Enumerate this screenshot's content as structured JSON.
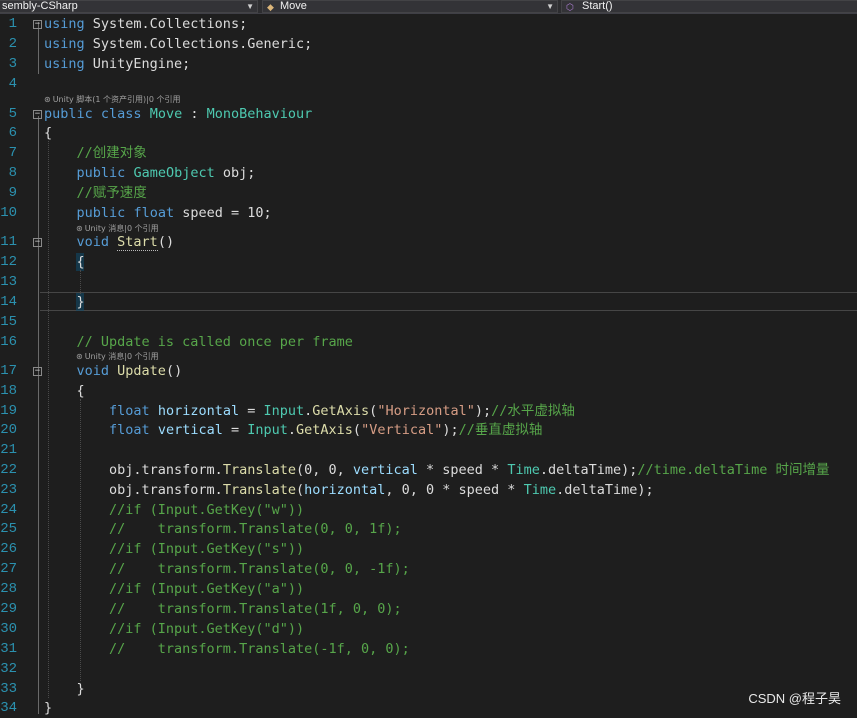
{
  "toolbar": {
    "project": "sembly-CSharp",
    "class": "Move",
    "member": "Start()",
    "class_icon": "class-icon",
    "method_icon": "method-icon"
  },
  "codelens": {
    "class": "Unity 脚本(1 个资产引用)|0 个引用",
    "start": "Unity 消息|0 个引用",
    "update": "Unity 消息|0 个引用"
  },
  "watermark": "CSDN @程子昊",
  "colors": {
    "keyword": "#569cd6",
    "type": "#4ec9b0",
    "method": "#dcdcaa",
    "string": "#d69d85",
    "comment": "#57a64a",
    "field": "#9cdcfe",
    "line_number": "#2b91af"
  },
  "lines": [
    {
      "n": "1",
      "tokens": [
        [
          "using",
          "keyword"
        ],
        [
          " System.Collections;",
          "plain"
        ]
      ]
    },
    {
      "n": "2",
      "tokens": [
        [
          "using",
          "keyword"
        ],
        [
          " System.Collections.Generic;",
          "plain"
        ]
      ]
    },
    {
      "n": "3",
      "tokens": [
        [
          "using",
          "keyword"
        ],
        [
          " UnityEngine;",
          "plain"
        ]
      ]
    },
    {
      "n": "4",
      "tokens": []
    },
    {
      "n": "5",
      "tokens": [
        [
          "public",
          "keyword"
        ],
        [
          " ",
          "plain"
        ],
        [
          "class",
          "keyword"
        ],
        [
          " ",
          "plain"
        ],
        [
          "Move",
          "type"
        ],
        [
          " : ",
          "plain"
        ],
        [
          "MonoBehaviour",
          "type"
        ]
      ]
    },
    {
      "n": "6",
      "tokens": [
        [
          "{",
          "plain"
        ]
      ]
    },
    {
      "n": "7",
      "tokens": [
        [
          "    //创建对象",
          "comment"
        ]
      ]
    },
    {
      "n": "8",
      "tokens": [
        [
          "    ",
          "plain"
        ],
        [
          "public",
          "keyword"
        ],
        [
          " ",
          "plain"
        ],
        [
          "GameObject",
          "type"
        ],
        [
          " obj;",
          "plain"
        ]
      ]
    },
    {
      "n": "9",
      "tokens": [
        [
          "    //赋予速度",
          "comment"
        ]
      ]
    },
    {
      "n": "10",
      "tokens": [
        [
          "    ",
          "plain"
        ],
        [
          "public",
          "keyword"
        ],
        [
          " ",
          "plain"
        ],
        [
          "float",
          "keyword"
        ],
        [
          " speed = 10;",
          "plain"
        ]
      ]
    },
    {
      "n": "11",
      "tokens": [
        [
          "    ",
          "plain"
        ],
        [
          "void",
          "keyword"
        ],
        [
          " ",
          "plain"
        ],
        [
          "Start",
          "method"
        ],
        [
          "()",
          "plain"
        ]
      ]
    },
    {
      "n": "12",
      "tokens": [
        [
          "    {",
          "plain"
        ]
      ]
    },
    {
      "n": "13",
      "tokens": []
    },
    {
      "n": "14",
      "tokens": [
        [
          "    }",
          "plain"
        ]
      ]
    },
    {
      "n": "15",
      "tokens": []
    },
    {
      "n": "16",
      "tokens": [
        [
          "    // Update is called once per frame",
          "comment"
        ]
      ]
    },
    {
      "n": "17",
      "tokens": [
        [
          "    ",
          "plain"
        ],
        [
          "void",
          "keyword"
        ],
        [
          " ",
          "plain"
        ],
        [
          "Update",
          "method"
        ],
        [
          "()",
          "plain"
        ]
      ]
    },
    {
      "n": "18",
      "tokens": [
        [
          "    {",
          "plain"
        ]
      ]
    },
    {
      "n": "19",
      "tokens": [
        [
          "        ",
          "plain"
        ],
        [
          "float",
          "keyword"
        ],
        [
          " ",
          "plain"
        ],
        [
          "horizontal",
          "field"
        ],
        [
          " = ",
          "plain"
        ],
        [
          "Input",
          "type"
        ],
        [
          ".",
          "plain"
        ],
        [
          "GetAxis",
          "method"
        ],
        [
          "(",
          "plain"
        ],
        [
          "\"Horizontal\"",
          "string"
        ],
        [
          ");",
          "plain"
        ],
        [
          "//水平虚拟轴",
          "comment"
        ]
      ]
    },
    {
      "n": "20",
      "tokens": [
        [
          "        ",
          "plain"
        ],
        [
          "float",
          "keyword"
        ],
        [
          " ",
          "plain"
        ],
        [
          "vertical",
          "field"
        ],
        [
          " = ",
          "plain"
        ],
        [
          "Input",
          "type"
        ],
        [
          ".",
          "plain"
        ],
        [
          "GetAxis",
          "method"
        ],
        [
          "(",
          "plain"
        ],
        [
          "\"Vertical\"",
          "string"
        ],
        [
          ");",
          "plain"
        ],
        [
          "//垂直虚拟轴",
          "comment"
        ]
      ]
    },
    {
      "n": "21",
      "tokens": []
    },
    {
      "n": "22",
      "tokens": [
        [
          "        obj.transform.",
          "plain"
        ],
        [
          "Translate",
          "method"
        ],
        [
          "(0, 0, ",
          "plain"
        ],
        [
          "vertical",
          "field"
        ],
        [
          " * speed * ",
          "plain"
        ],
        [
          "Time",
          "type"
        ],
        [
          ".deltaTime);",
          "plain"
        ],
        [
          "//time.deltaTime 时间增量",
          "comment"
        ]
      ]
    },
    {
      "n": "23",
      "tokens": [
        [
          "        obj.transform.",
          "plain"
        ],
        [
          "Translate",
          "method"
        ],
        [
          "(",
          "plain"
        ],
        [
          "horizontal",
          "field"
        ],
        [
          ", 0, 0 * speed * ",
          "plain"
        ],
        [
          "Time",
          "type"
        ],
        [
          ".deltaTime);",
          "plain"
        ]
      ]
    },
    {
      "n": "24",
      "tokens": [
        [
          "        //if (Input.GetKey(\"w\"))",
          "comment"
        ]
      ]
    },
    {
      "n": "25",
      "tokens": [
        [
          "        //    transform.Translate(0, 0, 1f);",
          "comment"
        ]
      ]
    },
    {
      "n": "26",
      "tokens": [
        [
          "        //if (Input.GetKey(\"s\"))",
          "comment"
        ]
      ]
    },
    {
      "n": "27",
      "tokens": [
        [
          "        //    transform.Translate(0, 0, -1f);",
          "comment"
        ]
      ]
    },
    {
      "n": "28",
      "tokens": [
        [
          "        //if (Input.GetKey(\"a\"))",
          "comment"
        ]
      ]
    },
    {
      "n": "29",
      "tokens": [
        [
          "        //    transform.Translate(1f, 0, 0);",
          "comment"
        ]
      ]
    },
    {
      "n": "30",
      "tokens": [
        [
          "        //if (Input.GetKey(\"d\"))",
          "comment"
        ]
      ]
    },
    {
      "n": "31",
      "tokens": [
        [
          "        //    transform.Translate(-1f, 0, 0);",
          "comment"
        ]
      ]
    },
    {
      "n": "32",
      "tokens": []
    },
    {
      "n": "33",
      "tokens": [
        [
          "    }",
          "plain"
        ]
      ]
    },
    {
      "n": "34",
      "tokens": [
        [
          "}",
          "plain"
        ]
      ]
    }
  ]
}
